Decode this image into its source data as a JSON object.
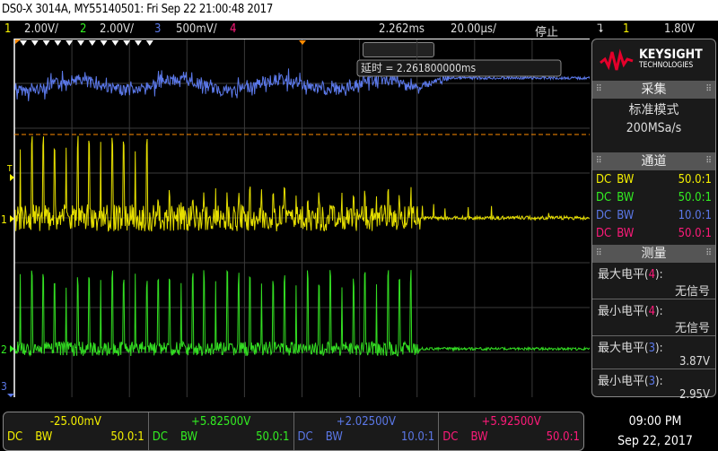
{
  "title": "DS0-X 3014A, MY55140501: Fri Sep 22 21:00:48 2017",
  "channels_bar": {
    "ch1_num": "1",
    "ch1_scale": "2.00V/",
    "ch2_num": "2",
    "ch2_scale": "2.00V/",
    "ch3_num": "3",
    "ch3_scale": "500mV/",
    "ch4_num": "4",
    "delay": "2.262ms",
    "timebase": "20.00µs/",
    "run_state": "停止",
    "trigger_icon": "falling-edge-icon",
    "trigger_source": "1",
    "trigger_level": "1.80V"
  },
  "colors": {
    "ch1": "#f5f000",
    "ch2": "#33ee22",
    "ch3": "#5b78e8",
    "ch4": "#ff1a7a",
    "trigger": "#ff8c00"
  },
  "plot": {
    "delay_readout": "延时 = 2.261800000ms",
    "ch1_marker": "1",
    "ch2_marker": "2",
    "ch3_marker": "3",
    "trigger_marker": "T"
  },
  "sidebar": {
    "brand": "KEYSIGHT",
    "brand_sub": "TECHNOLOGIES",
    "acq_header": "采集",
    "acq_mode": "标准模式",
    "sample_rate": "200MSa/s",
    "chan_header": "通道",
    "channels": [
      {
        "coupling": "DC",
        "bw": "BW",
        "probe": "50.0:1"
      },
      {
        "coupling": "DC",
        "bw": "BW",
        "probe": "50.0:1"
      },
      {
        "coupling": "DC",
        "bw": "BW",
        "probe": "10.0:1"
      },
      {
        "coupling": "DC",
        "bw": "BW",
        "probe": "50.0:1"
      }
    ],
    "meas_header": "测量",
    "measurements": [
      {
        "label": "最大电平(",
        "ch": "4",
        "end": "):",
        "value": "无信号"
      },
      {
        "label": "最小电平(",
        "ch": "4",
        "end": "):",
        "value": "无信号"
      },
      {
        "label": "最大电平(",
        "ch": "3",
        "end": "):",
        "value": "3.87V"
      },
      {
        "label": "最小电平(",
        "ch": "3",
        "end": "):",
        "value": "2.95V"
      }
    ]
  },
  "bottom": [
    {
      "offset": "-25.00mV",
      "coupling": "DC",
      "bw": "BW",
      "probe": "50.0:1"
    },
    {
      "offset": "+5.82500V",
      "coupling": "DC",
      "bw": "BW",
      "probe": "50.0:1"
    },
    {
      "offset": "+2.02500V",
      "coupling": "DC",
      "bw": "BW",
      "probe": "10.0:1"
    },
    {
      "offset": "+5.92500V",
      "coupling": "DC",
      "bw": "BW",
      "probe": "50.0:1"
    }
  ],
  "clock": {
    "time": "09:00 PM",
    "date": "Sep 22, 2017"
  }
}
